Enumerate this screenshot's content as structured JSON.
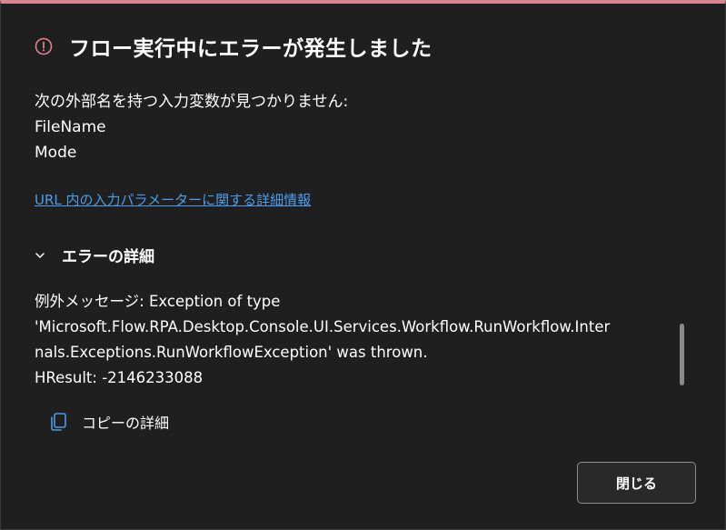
{
  "dialog": {
    "title": "フロー実行中にエラーが発生しました",
    "title_icon": "error-circle-icon",
    "accent_color": "#d9858f",
    "message": {
      "line1": "次の外部名を持つ入力変数が見つかりません:",
      "line2": "FileName",
      "line3": "Mode"
    },
    "link_text": "URL 内の入力パラメーターに関する詳細情報",
    "link_color": "#4a9eea",
    "details": {
      "title": "エラーの詳細",
      "toggle_icon": "chevron-down-icon",
      "lines": [
        "例外メッセージ: Exception of type",
        "'Microsoft.Flow.RPA.Desktop.Console.UI.Services.Workflow.RunWorkflow.Inter",
        "nals.Exceptions.RunWorkflowException' was thrown.",
        "HResult: -2146233088"
      ]
    },
    "copy": {
      "icon": "copy-icon",
      "label": "コピーの詳細"
    },
    "close_label": "閉じる"
  }
}
